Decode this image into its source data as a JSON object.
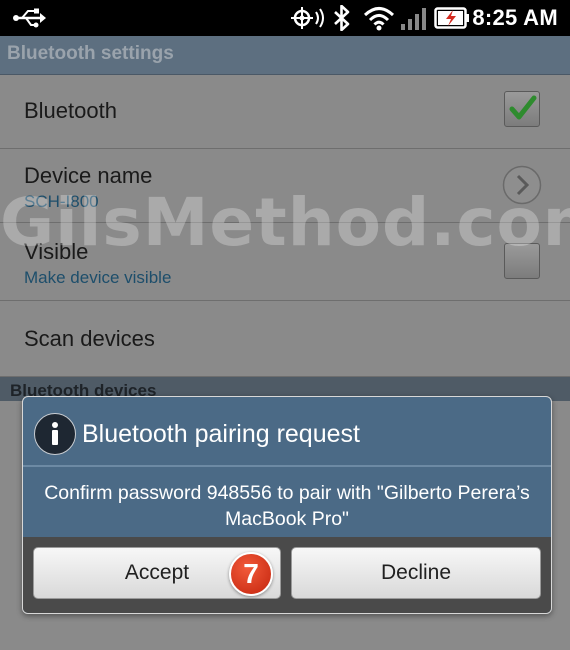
{
  "status_bar": {
    "time": "8:25 AM",
    "icons": [
      "usb-icon",
      "gps-icon",
      "bluetooth-icon",
      "wifi-icon",
      "signal-icon",
      "battery-charging-icon"
    ]
  },
  "header": {
    "title": "Bluetooth settings"
  },
  "settings": {
    "bluetooth": {
      "label": "Bluetooth",
      "checked": true
    },
    "device_name": {
      "label": "Device name",
      "value": "SCH-I800"
    },
    "visible": {
      "label": "Visible",
      "summary": "Make device visible",
      "checked": false
    },
    "scan": {
      "label": "Scan devices"
    }
  },
  "section": {
    "title": "Bluetooth devices"
  },
  "watermark": "GilsMethod.com",
  "dialog": {
    "title": "Bluetooth pairing request",
    "message": "Confirm password 948556 to pair with \"Gilberto Perera’s MacBook Pro\"",
    "accept_label": "Accept",
    "decline_label": "Decline",
    "icon": "info-icon"
  },
  "step_marker": "7",
  "colors": {
    "header": "#5d6f80",
    "dialog": "#4b6a86",
    "check_green": "#2e8b2e",
    "link_blue": "#1d4e6b",
    "marker_red": "#d83418"
  }
}
